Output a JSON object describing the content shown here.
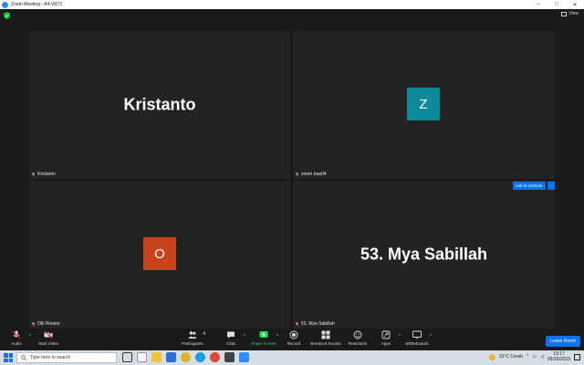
{
  "window": {
    "title": "Zoom Meeting - A4-VR71",
    "controls": [
      "–",
      "□",
      "✕"
    ]
  },
  "header": {
    "view_label": "View"
  },
  "tiles": [
    {
      "display_text": "Kristanto",
      "name_tag": "Kristanto"
    },
    {
      "avatar_letter": "Z",
      "avatar_color": "#0e8a9a",
      "name_tag": "zoom baa04"
    },
    {
      "avatar_letter": "O",
      "avatar_color": "#c9421b",
      "name_tag": "Oki Rivano"
    },
    {
      "display_text": "53. Mya Sabillah",
      "name_tag": "53. Mya Sabillah"
    }
  ],
  "ask_to_unmute": {
    "label": "Ask to Unmute",
    "more": "···"
  },
  "toolbar": {
    "audio": "Audio",
    "start_video": "Start Video",
    "participants": "Participants",
    "participants_count": "4",
    "chat": "Chat",
    "share_screen": "Share Screen",
    "record": "Record",
    "breakout_rooms": "Breakout Rooms",
    "reactions": "Reactions",
    "apps": "Apps",
    "whiteboards": "Whiteboards",
    "leave": "Leave Room"
  },
  "taskbar": {
    "search_placeholder": "Type here to search",
    "weather": "31°C  Cerah",
    "time": "19:17",
    "date": "05/26/2023"
  },
  "colors": {
    "accent": "#0e72ed",
    "share_green": "#23d959",
    "muted_red": "#e02828"
  }
}
